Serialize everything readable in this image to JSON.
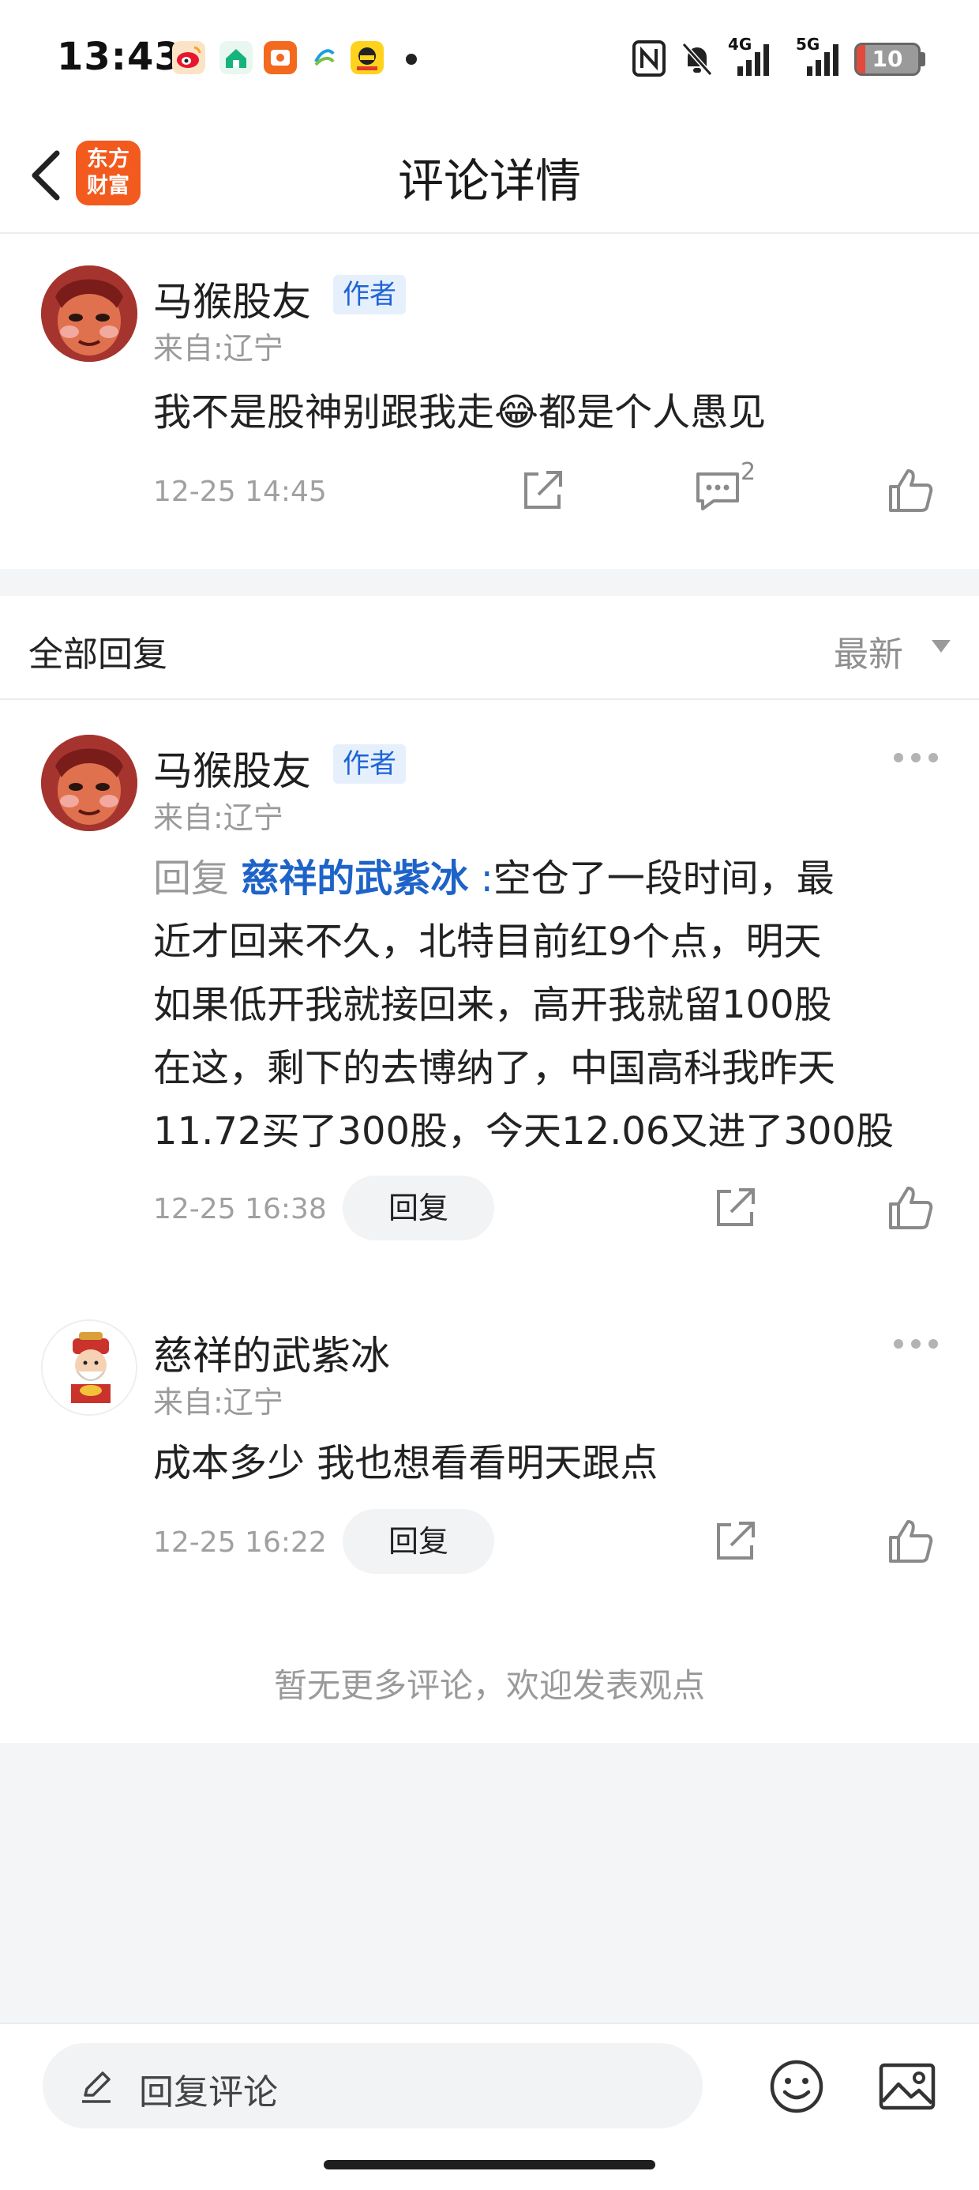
{
  "status_bar": {
    "time": "13:43",
    "network_4g": "4G",
    "network_5g": "5G",
    "battery_level": "10"
  },
  "header": {
    "title": "评论详情",
    "logo_line1": "东方",
    "logo_line2": "财富"
  },
  "main_comment": {
    "author": "马猴股友",
    "author_tag": "作者",
    "location": "来自:辽宁",
    "content": "我不是股神别跟我走😂都是个人愚见",
    "time": "12-25 14:45",
    "reply_count": "2"
  },
  "replies_header": {
    "title": "全部回复",
    "sort": "最新"
  },
  "replies": [
    {
      "author": "马猴股友",
      "author_tag": "作者",
      "location": "来自:辽宁",
      "reply_prefix": "回复",
      "reply_target": "慈祥的武紫冰",
      "reply_colon": ":",
      "lines": [
        "空仓了一段时间，最",
        "近才回来不久，北特目前红9个点，明天",
        "如果低开我就接回来，高开我就留100股",
        "在这，剩下的去博纳了，中国高科我昨天",
        "11.72买了300股，今天12.06又进了300股"
      ],
      "time": "12-25 16:38",
      "reply_button": "回复"
    },
    {
      "author": "慈祥的武紫冰",
      "location": "来自:辽宁",
      "content": "成本多少 我也想看看明天跟点",
      "time": "12-25 16:22",
      "reply_button": "回复"
    }
  ],
  "end_note": "暂无更多评论，欢迎发表观点",
  "bottom_bar": {
    "input_placeholder": "回复评论"
  },
  "colors": {
    "accent_blue": "#1d63c9",
    "logo_orange": "#f25a1e",
    "battery_red": "#e24b3b"
  },
  "icons": [
    "back-arrow-icon",
    "share-icon",
    "comment-icon",
    "thumbs-up-icon",
    "more-dots-icon",
    "pen-icon",
    "emoji-icon",
    "image-icon"
  ]
}
